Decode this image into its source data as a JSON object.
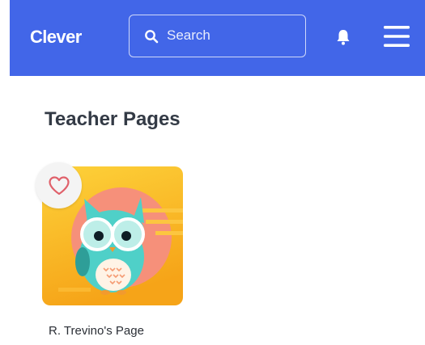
{
  "header": {
    "logo_text": "Clever",
    "search": {
      "placeholder": "Search",
      "value": ""
    },
    "bell_icon": "bell-icon",
    "menu_icon": "hamburger-menu-icon"
  },
  "main": {
    "section_title": "Teacher Pages",
    "cards": [
      {
        "label": "R. Trevino's Page",
        "image": "owl-avatar",
        "favorite_icon": "heart-outline-icon",
        "favorited": false
      }
    ]
  },
  "colors": {
    "brand_blue": "#4266e8",
    "card_yellow": "#fbbf2c",
    "owl_teal": "#4fd0c8",
    "heart_red": "#e0606a"
  }
}
